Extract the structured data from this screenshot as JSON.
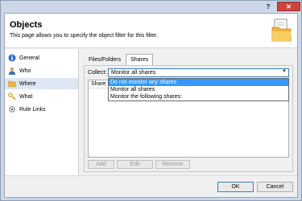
{
  "titlebar": {
    "help_label": "?",
    "close_label": "✕"
  },
  "header": {
    "title": "Objects",
    "subtitle": "This page allows you to specify the object filter for this filter."
  },
  "nav": {
    "items": [
      {
        "label": "General",
        "icon": "info-icon"
      },
      {
        "label": "Who",
        "icon": "user-icon"
      },
      {
        "label": "Where",
        "icon": "folder-icon",
        "selected": true
      },
      {
        "label": "What",
        "icon": "key-icon"
      },
      {
        "label": "Rule Links",
        "icon": "gear-icon"
      }
    ]
  },
  "tabs": [
    "Files/Folders",
    "Shares"
  ],
  "collect": {
    "label": "Collect:",
    "value": "Monitor all shares",
    "options": [
      "Do not monitor any shares",
      "Monitor all shares",
      "Monitor the following shares:"
    ],
    "highlighted_index": 0
  },
  "list": {
    "column": "Share"
  },
  "actions": {
    "add": "Add",
    "edit": "Edit",
    "remove": "Remove"
  },
  "footer": {
    "ok": "OK",
    "cancel": "Cancel"
  }
}
